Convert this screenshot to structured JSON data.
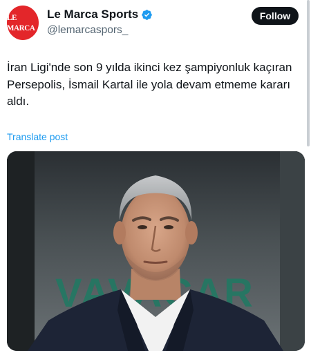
{
  "author": {
    "avatar_text": "LE MARCA",
    "display_name": "Le Marca Sports",
    "handle": "@lemarcaspors_",
    "verified": true
  },
  "actions": {
    "follow_label": "Follow"
  },
  "post": {
    "text": "İran Ligi'nde son 9 yılda ikinci kez şampiyonluk kaçıran Persepolis, İsmail Kartal ile yola devam etmeme kararı aldı.",
    "translate_label": "Translate post"
  },
  "media": {
    "background_banner_text": "VAVACAR",
    "description_icon": "photo-man-portrait"
  },
  "colors": {
    "avatar_bg": "#e3262a",
    "follow_bg": "#0f1419",
    "link": "#1d9bf0",
    "verified": "#1d9bf0",
    "banner_text": "#1f7a63"
  }
}
